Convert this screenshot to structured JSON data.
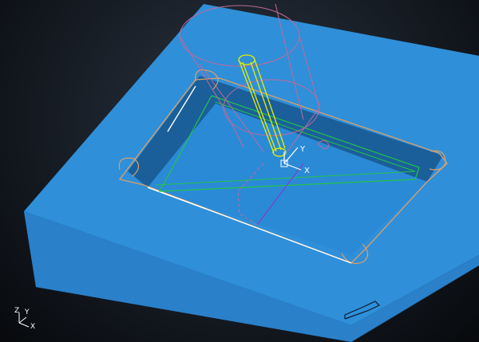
{
  "viewport": {
    "name": "3D CAM viewport",
    "background": "#161c24"
  },
  "colors": {
    "block_top": "#2f8fd9",
    "block_side": "#1f6fb3",
    "block_front": "#2a80c9",
    "pocket_floor": "#2b8ad6",
    "pocket_wall": "#1a5f9a",
    "edge_orange": "#d9a06a",
    "toolpath_green": "#22c44a",
    "tool_yellow": "#e6f000",
    "holder_pink": "#c06a9a",
    "toolpath_purple": "#7a3fd0",
    "edge_white": "#ffffff"
  },
  "work_csys": {
    "labels": {
      "x": "X",
      "y": "Y"
    }
  },
  "triad": {
    "labels": {
      "z": "Z",
      "y": "Y",
      "x": "X"
    }
  }
}
